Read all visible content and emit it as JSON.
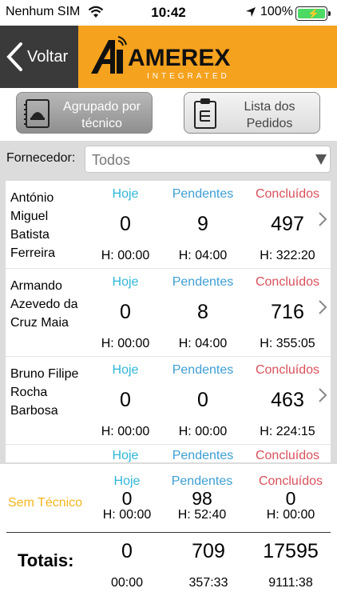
{
  "status_bar": {
    "carrier": "Nenhum SIM",
    "time": "10:42",
    "battery": "100%"
  },
  "header": {
    "back_label": "Voltar",
    "logo_text": "AMEREX",
    "logo_sub": "INTEGRATED"
  },
  "toggles": {
    "grouped_label": "Agrupado por técnico",
    "orders_label": "Lista dos Pedidos"
  },
  "filter": {
    "label": "Fornecedor:",
    "selected": "Todos"
  },
  "columns": {
    "today": "Hoje",
    "pending": "Pendentes",
    "done": "Concluídos"
  },
  "technicians": [
    {
      "name": "António Miguel Batista Ferreira",
      "today": "0",
      "pending": "9",
      "done": "497",
      "today_h": "H: 00:00",
      "pending_h": "H: 04:00",
      "done_h": "H: 322:20"
    },
    {
      "name": "Armando Azevedo da Cruz Maia",
      "today": "0",
      "pending": "8",
      "done": "716",
      "today_h": "H: 00:00",
      "pending_h": "H: 04:00",
      "done_h": "H: 355:05"
    },
    {
      "name": "Bruno Filipe Rocha Barbosa",
      "today": "0",
      "pending": "0",
      "done": "463",
      "today_h": "H: 00:00",
      "pending_h": "H: 00:00",
      "done_h": "H: 224:15"
    },
    {
      "name": "",
      "today": "",
      "pending": "",
      "done": "",
      "today_h": "",
      "pending_h": "",
      "done_h": ""
    }
  ],
  "no_technician": {
    "label": "Sem Técnico",
    "today": "0",
    "pending": "98",
    "done": "0",
    "today_h": "H: 00:00",
    "pending_h": "H: 52:40",
    "done_h": "H: 00:00"
  },
  "totals": {
    "label": "Totais:",
    "today": "0",
    "pending": "709",
    "done": "17595",
    "today_h": "00:00",
    "pending_h": "357:33",
    "done_h": "9111:38"
  },
  "colors": {
    "brand_orange": "#f5a21e",
    "today": "#2fb6d8",
    "pending": "#3d9fd4",
    "done": "#d9505a",
    "no_tech": "#f5b51e"
  }
}
